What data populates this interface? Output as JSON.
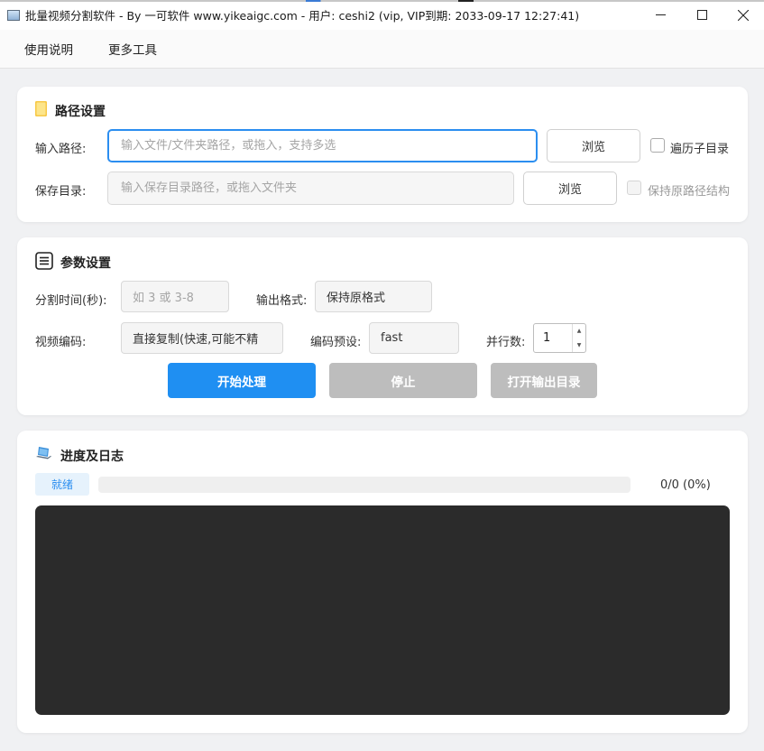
{
  "window": {
    "title": "批量视频分割软件  - By 一可软件 www.yikeaigc.com - 用户: ceshi2 (vip, VIP到期: 2033-09-17 12:27:41)",
    "minimize_icon": "minimize-icon",
    "maximize_icon": "maximize-icon",
    "close_icon": "close-icon"
  },
  "menu": {
    "items": [
      "使用说明",
      "更多工具"
    ]
  },
  "path_settings": {
    "title": "路径设置",
    "icon": "folder-icon",
    "input_label": "输入路径:",
    "input_value": "",
    "input_placeholder": "输入文件/文件夹路径，或拖入，支持多选",
    "browse_label": "浏览",
    "recurse_label": "遍历子目录",
    "recurse_checked": false,
    "save_label": "保存目录:",
    "save_value": "",
    "save_placeholder": "输入保存目录路径，或拖入文件夹",
    "save_browse_label": "浏览",
    "keep_structure_label": "保持原路径结构",
    "keep_structure_checked": false
  },
  "params": {
    "title": "参数设置",
    "icon": "list-icon",
    "split_time_label": "分割时间(秒):",
    "split_time_placeholder": "如 3 或 3-8",
    "output_format_label": "输出格式:",
    "output_format_value": "保持原格式",
    "video_codec_label": "视频编码:",
    "video_codec_value": "直接复制(快速,可能不精",
    "preset_label": "编码预设:",
    "preset_value": "fast",
    "parallel_label": "并行数:",
    "parallel_value": "1",
    "start_label": "开始处理",
    "stop_label": "停止",
    "open_output_label": "打开输出目录"
  },
  "progress": {
    "title": "进度及日志",
    "icon": "laptop-icon",
    "status": "就绪",
    "progress_fraction": 0,
    "count_text": "0/0 (0%)",
    "log_text": ""
  },
  "colors": {
    "accent": "#2b8ef0",
    "start_button": "#1f8ff2",
    "disabled_button": "#bdbdbd",
    "log_background": "#2b2b2b"
  }
}
